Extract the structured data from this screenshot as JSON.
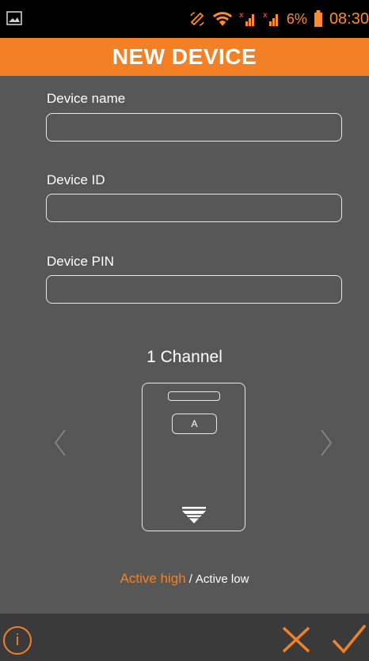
{
  "status_bar": {
    "battery_percent": "6%",
    "time": "08:30",
    "accent_color": "#ff8a2b"
  },
  "header": {
    "title": "NEW DEVICE",
    "background_color": "#f48026"
  },
  "form": {
    "device_name": {
      "label": "Device name",
      "value": "",
      "placeholder": ""
    },
    "device_id": {
      "label": "Device ID",
      "value": "",
      "placeholder": ""
    },
    "device_pin": {
      "label": "Device PIN",
      "value": "",
      "placeholder": ""
    }
  },
  "channel_selector": {
    "title": "1 Channel",
    "button_label": "A",
    "prev_icon": "chevron-left-icon",
    "next_icon": "chevron-right-icon"
  },
  "active_mode": {
    "high_label": "Active high",
    "separator": "/",
    "low_label": "Active low",
    "selected": "Active high",
    "selected_color": "#f48026"
  },
  "footer": {
    "info_label": "i",
    "cancel_icon": "close-icon",
    "confirm_icon": "check-icon"
  }
}
